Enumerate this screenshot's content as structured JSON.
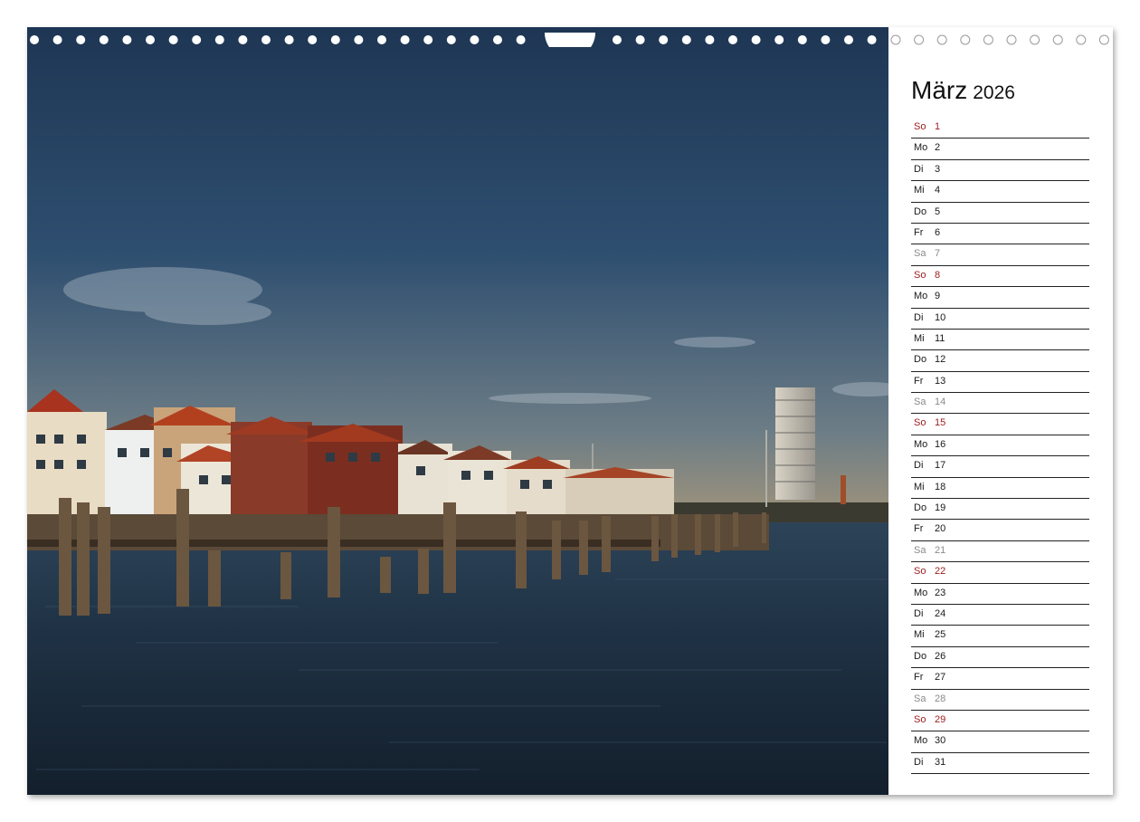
{
  "calendar": {
    "month": "März",
    "year": "2026",
    "colors": {
      "sunday": "#9b1b1b",
      "saturday": "#8a8a8a",
      "weekday": "#1a1a1a"
    },
    "days": [
      {
        "weekday": "So",
        "day": "1"
      },
      {
        "weekday": "Mo",
        "day": "2"
      },
      {
        "weekday": "Di",
        "day": "3"
      },
      {
        "weekday": "Mi",
        "day": "4"
      },
      {
        "weekday": "Do",
        "day": "5"
      },
      {
        "weekday": "Fr",
        "day": "6"
      },
      {
        "weekday": "Sa",
        "day": "7"
      },
      {
        "weekday": "So",
        "day": "8"
      },
      {
        "weekday": "Mo",
        "day": "9"
      },
      {
        "weekday": "Di",
        "day": "10"
      },
      {
        "weekday": "Mi",
        "day": "11"
      },
      {
        "weekday": "Do",
        "day": "12"
      },
      {
        "weekday": "Fr",
        "day": "13"
      },
      {
        "weekday": "Sa",
        "day": "14"
      },
      {
        "weekday": "So",
        "day": "15"
      },
      {
        "weekday": "Mo",
        "day": "16"
      },
      {
        "weekday": "Di",
        "day": "17"
      },
      {
        "weekday": "Mi",
        "day": "18"
      },
      {
        "weekday": "Do",
        "day": "19"
      },
      {
        "weekday": "Fr",
        "day": "20"
      },
      {
        "weekday": "Sa",
        "day": "21"
      },
      {
        "weekday": "So",
        "day": "22"
      },
      {
        "weekday": "Mo",
        "day": "23"
      },
      {
        "weekday": "Di",
        "day": "24"
      },
      {
        "weekday": "Mi",
        "day": "25"
      },
      {
        "weekday": "Do",
        "day": "26"
      },
      {
        "weekday": "Fr",
        "day": "27"
      },
      {
        "weekday": "Sa",
        "day": "28"
      },
      {
        "weekday": "So",
        "day": "29"
      },
      {
        "weekday": "Mo",
        "day": "30"
      },
      {
        "weekday": "Di",
        "day": "31"
      }
    ]
  },
  "photo": {
    "icon": "harbor-waterfront-photo",
    "sky_color": "#1f3a5e",
    "water_color": "#1d2d3e"
  }
}
